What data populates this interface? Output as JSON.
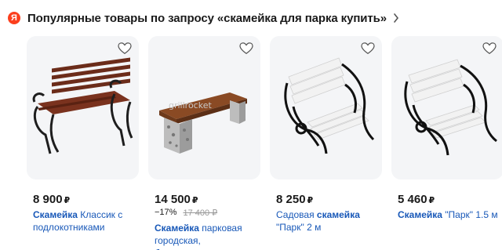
{
  "header": {
    "logo_letter": "Я",
    "title": "Популярные товары по запросу «скамейка для парка купить»"
  },
  "colors": {
    "accent": "#fc3f1d",
    "link": "#1858b8",
    "card_bg": "#f4f5f7"
  },
  "products": [
    {
      "price": "8 900",
      "currency": "₽",
      "title_highlight": "Скамейка",
      "title_rest": " Классик с подлокотниками",
      "favorite_icon": "heart-outline-icon"
    },
    {
      "price": "14 500",
      "currency": "₽",
      "discount": "−17%",
      "old_price": "17 400 ₽",
      "title_highlight": "Скамейка",
      "title_rest": " парковая городская, бульварная…",
      "watermark": "grillrocket",
      "favorite_icon": "heart-outline-icon"
    },
    {
      "price": "8 250",
      "currency": "₽",
      "title_prefix": "Садовая ",
      "title_highlight": "скамейка",
      "title_rest": " \"Парк\" 2 м",
      "favorite_icon": "heart-outline-icon"
    },
    {
      "price": "5 460",
      "currency": "₽",
      "title_highlight": "Скамейка",
      "title_rest": " \"Парк\" 1.5 м",
      "favorite_icon": "heart-outline-icon"
    }
  ]
}
